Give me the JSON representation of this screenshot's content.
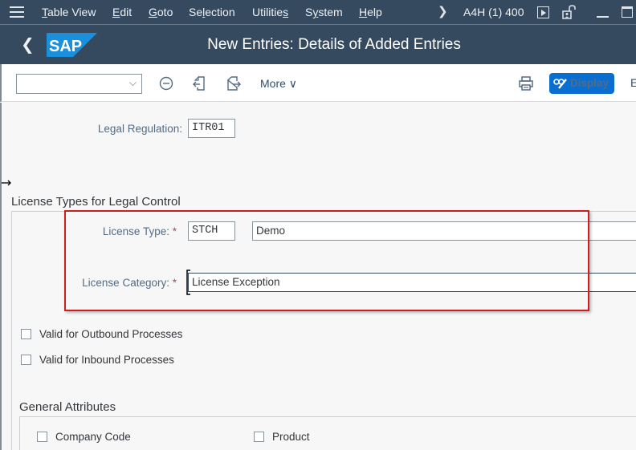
{
  "menubar": {
    "items": [
      {
        "label": "Table View",
        "mnemonic": "T"
      },
      {
        "label": "Edit",
        "mnemonic": "E"
      },
      {
        "label": "Goto",
        "mnemonic": "G"
      },
      {
        "label": "Selection",
        "mnemonic": "l"
      },
      {
        "label": "Utilities",
        "mnemonic": "s"
      },
      {
        "label": "System",
        "mnemonic": "y"
      },
      {
        "label": "Help",
        "mnemonic": "H"
      }
    ],
    "system_info": "A4H (1) 400",
    "icons": [
      "menu-icon",
      "chevron-right-icon",
      "play-icon",
      "unlock-icon",
      "minimize-icon",
      "maximize-icon"
    ]
  },
  "shellbar": {
    "logo_text": "SAP",
    "title": "New Entries: Details of Added Entries"
  },
  "toolbar": {
    "command_field_value": "",
    "more_label": "More",
    "display_label": "Display",
    "overflow_label": "E",
    "icons": [
      "cancel-icon",
      "previous-entry-icon",
      "next-entry-icon",
      "print-icon",
      "display-change-icon"
    ]
  },
  "header_fields": {
    "legal_regulation_label": "Legal Regulation:",
    "legal_regulation_value": "ITR01"
  },
  "license_types_section": {
    "title": "License Types for Legal Control",
    "license_type_label": "License Type:",
    "license_type_value": "STCH",
    "license_type_description": "Demo",
    "license_category_label": "License Category:",
    "license_category_value": "License Exception",
    "required_marker": "*",
    "checkboxes": [
      {
        "label": "Valid for Outbound Processes",
        "checked": false
      },
      {
        "label": "Valid for Inbound Processes",
        "checked": false
      }
    ]
  },
  "general_attributes_section": {
    "title": "General Attributes",
    "checkboxes": [
      {
        "label": "Company Code",
        "checked": false
      },
      {
        "label": "Product",
        "checked": false
      }
    ]
  },
  "colors": {
    "shell": "#354a5f",
    "accent": "#0a6ed1",
    "highlight_box": "#cc1f1f",
    "required": "#d9364c"
  }
}
